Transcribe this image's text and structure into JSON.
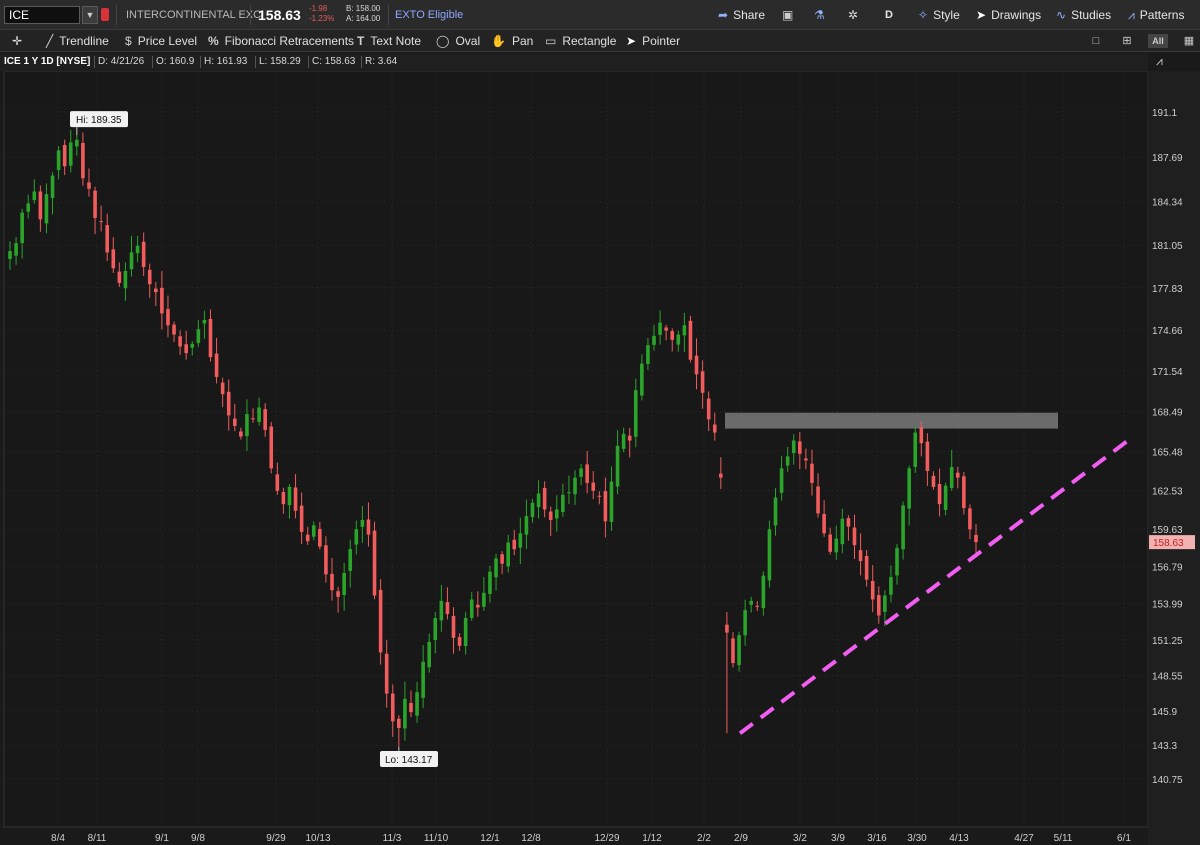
{
  "toolbar": {
    "symbol": "ICE",
    "company": "INTERCONTINENTAL EXC",
    "last": "158.63",
    "change": "-1.98",
    "change_pct": "-1.23%",
    "bid": "B: 158.00",
    "ask": "A: 164.00",
    "exto": "EXTO Eligible",
    "share_label": "Share",
    "period_label": "D",
    "style_label": "Style",
    "drawings_label": "Drawings",
    "studies_label": "Studies",
    "patterns_label": "Patterns"
  },
  "drawing_tools": {
    "trendline": "Trendline",
    "price_level": "Price Level",
    "fibonacci": "Fibonacci Retracements",
    "text_note": "Text Note",
    "oval": "Oval",
    "pan": "Pan",
    "rectangle": "Rectangle",
    "pointer": "Pointer",
    "all_label": "All"
  },
  "info": {
    "title": "ICE 1 Y 1D [NYSE]",
    "date": "D: 4/21/26",
    "open": "O: 160.9",
    "high": "H: 161.93",
    "low": "L: 158.29",
    "close": "C: 158.63",
    "range": "R: 3.64"
  },
  "colors": {
    "up": "#2aa52a",
    "down": "#f25c5c",
    "trendline": "#f15ef1",
    "zone": "#7a7a7a",
    "price_tag": "#f3b2b2"
  },
  "chart_data": {
    "type": "candlestick",
    "y_ticks": [
      191.1,
      187.69,
      184.34,
      181.05,
      177.83,
      174.66,
      171.54,
      168.49,
      165.48,
      162.53,
      159.63,
      156.79,
      153.99,
      151.25,
      148.55,
      145.9,
      143.3,
      140.75
    ],
    "x_ticks": [
      "8/4",
      "8/11",
      "9/1",
      "9/8",
      "9/29",
      "10/13",
      "11/3",
      "11/10",
      "12/1",
      "12/8",
      "12/29",
      "1/12",
      "2/2",
      "2/9",
      "3/2",
      "3/9",
      "3/16",
      "3/30",
      "4/13",
      "4/27",
      "5/11",
      "6/1"
    ],
    "last_price": "158.63",
    "high_label": "Hi: 189.35",
    "low_label": "Lo: 143.17",
    "high": 189.35,
    "low": 143.17,
    "resistance_zone": [
      167.2,
      168.4
    ],
    "trendline": {
      "from": 144.2,
      "to": 166.3
    },
    "closes": [
      180.6,
      181.2,
      183.5,
      184.2,
      185.1,
      183.0,
      184.9,
      186.3,
      188.2,
      187.0,
      188.8,
      189.0,
      186.1,
      185.3,
      183.1,
      182.8,
      180.5,
      179.3,
      178.2,
      179.1,
      180.5,
      181.0,
      179.4,
      178.1,
      177.5,
      175.9,
      175.0,
      174.3,
      173.4,
      172.9,
      173.6,
      174.7,
      175.4,
      172.6,
      171.1,
      169.8,
      168.2,
      167.4,
      166.6,
      168.3,
      167.9,
      168.8,
      167.1,
      164.2,
      162.5,
      161.5,
      162.8,
      161.0,
      159.4,
      158.7,
      159.9,
      158.3,
      156.2,
      155.0,
      154.5,
      156.3,
      158.1,
      159.6,
      160.3,
      159.2,
      154.6,
      150.3,
      147.2,
      145.1,
      144.6,
      146.8,
      145.8,
      147.3,
      149.6,
      151.1,
      152.9,
      154.2,
      153.2,
      151.4,
      150.8,
      152.9,
      154.3,
      153.7,
      154.8,
      156.4,
      157.4,
      157.0,
      158.6,
      158.1,
      159.3,
      160.6,
      161.6,
      162.3,
      161.1,
      160.3,
      161.1,
      162.2,
      162.4,
      163.5,
      164.2,
      163.1,
      162.5,
      162.1,
      160.2,
      163.2,
      165.9,
      166.8,
      166.3,
      170.1,
      172.1,
      173.5,
      174.2,
      175.2,
      174.6,
      173.9,
      174.3,
      175.0,
      172.4,
      171.3,
      169.9,
      167.9,
      166.9,
      163.5,
      151.8,
      149.5,
      151.6,
      153.5,
      154.2,
      153.8,
      156.1,
      159.6,
      162.0,
      164.2,
      165.1,
      166.3,
      165.3,
      164.8,
      163.1,
      160.8,
      159.3,
      157.9,
      158.9,
      160.4,
      159.8,
      158.4,
      157.2,
      155.8,
      154.3,
      153.1,
      154.6,
      156.0,
      158.2,
      161.4,
      164.2,
      166.9,
      166.1,
      164.0,
      162.8,
      161.5,
      162.9,
      164.3,
      163.5,
      161.2,
      159.6,
      158.63
    ]
  }
}
